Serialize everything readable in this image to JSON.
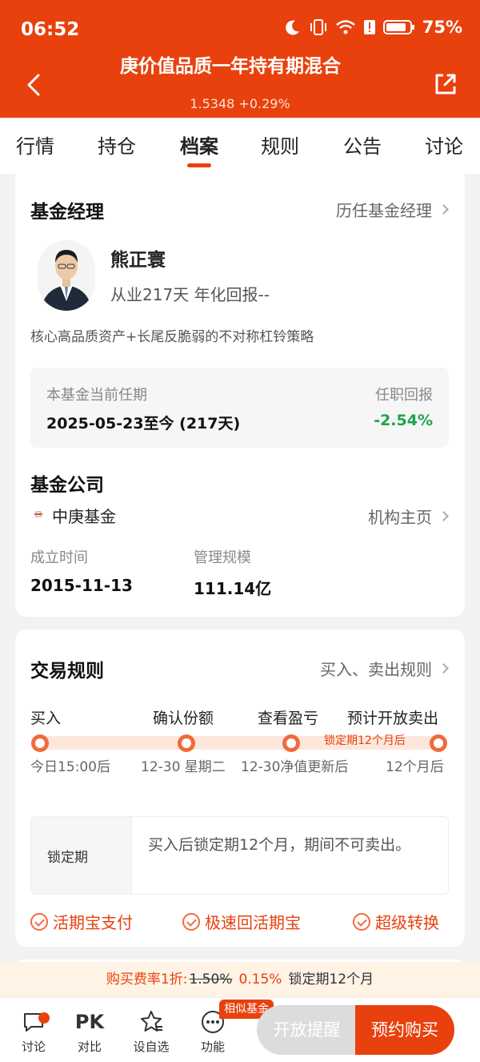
{
  "status_bar": {
    "time": "06:52",
    "battery": "75%"
  },
  "header": {
    "title": "庚价值品质一年持有期混合",
    "subtitle": "1.5348 +0.29%"
  },
  "tabs": [
    "行情",
    "持仓",
    "档案",
    "规则",
    "公告",
    "讨论"
  ],
  "active_tab": "档案",
  "manager_section": {
    "title": "基金经理",
    "link": "历任基金经理",
    "name": "熊正寰",
    "info": "从业217天 年化回报--",
    "strategy": "核心高品质资产+长尾反脆弱的不对称杠铃策略",
    "tenure_label": "本基金当前任期",
    "tenure_value": "2025-05-23至今 (217天)",
    "return_label": "任职回报",
    "return_value": "-2.54%"
  },
  "company_section": {
    "title": "基金公司",
    "name": "中庚基金",
    "link": "机构主页",
    "founded_label": "成立时间",
    "founded_value": "2015-11-13",
    "scale_label": "管理规模",
    "scale_value": "111.14亿"
  },
  "trade_section": {
    "title": "交易规则",
    "link": "买入、卖出规则",
    "steps": [
      {
        "label": "买入",
        "sub": "今日15:00后"
      },
      {
        "label": "确认份额",
        "sub": "12-30 星期二"
      },
      {
        "label": "查看盈亏",
        "sub": "12-30净值更新后"
      },
      {
        "label": "预计开放卖出",
        "sub": "12个月后"
      }
    ],
    "lock_tag": "锁定期12个月后",
    "lock_label": "锁定期",
    "lock_text": "买入后锁定期12个月，期间不可卖出。",
    "features": [
      "活期宝支付",
      "极速回活期宝",
      "超级转换"
    ]
  },
  "fee_bar": {
    "prefix": "购买费率1折:",
    "old": "1.50%",
    "new": "0.15%",
    "lock": "锁定期12个月"
  },
  "bottom_bar": {
    "items": [
      "讨论",
      "对比",
      "设自选",
      "功能"
    ],
    "pk": "PK",
    "similar_badge": "相似基金",
    "remind_button": "开放提醒",
    "buy_button": "预约购买"
  },
  "colors": {
    "brand": "#e8410e",
    "positive": "#1ea34a"
  },
  "icons": [
    "back-icon",
    "share-icon",
    "moon-icon",
    "vibrate-icon",
    "wifi-icon",
    "alert-icon",
    "battery-icon",
    "chat-icon",
    "star-icon",
    "more-icon",
    "check-icon"
  ]
}
